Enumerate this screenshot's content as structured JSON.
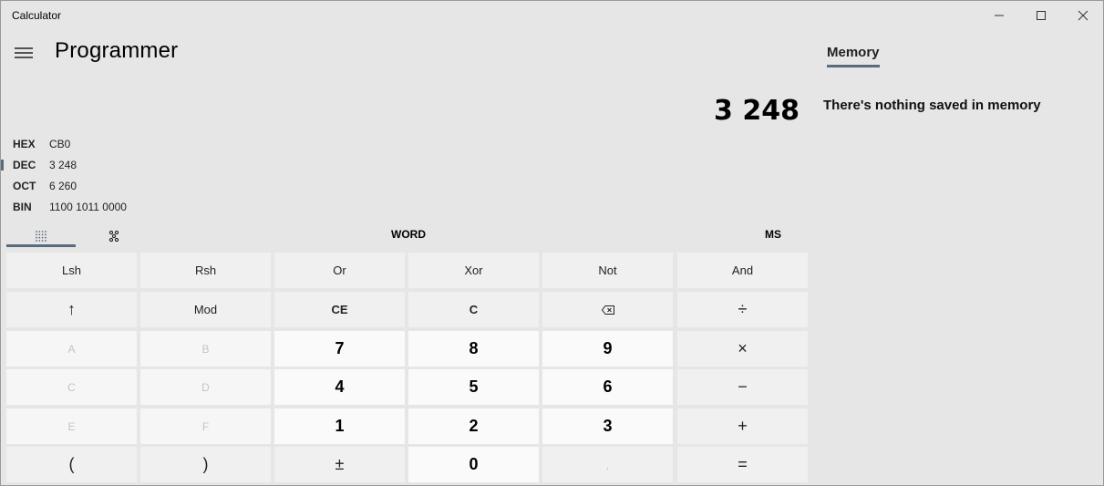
{
  "window": {
    "title": "Calculator",
    "controls": [
      "minimize-icon",
      "maximize-icon",
      "close-icon"
    ]
  },
  "header": {
    "menu_icon": "hamburger-menu-icon",
    "mode": "Programmer"
  },
  "display": {
    "value": "3 248"
  },
  "radix": [
    {
      "label": "HEX",
      "value": "CB0"
    },
    {
      "label": "DEC",
      "value": "3 248",
      "selected": true
    },
    {
      "label": "OCT",
      "value": "6 260"
    },
    {
      "label": "BIN",
      "value": "1100 1011 0000"
    }
  ],
  "toolbar": {
    "keypad_tab_icon": "full-keypad-icon",
    "bit_toggle_tab_icon": "bit-toggling-keypad-icon",
    "word_size": "WORD",
    "memory_store": "MS"
  },
  "keypad": {
    "row1": [
      "Lsh",
      "Rsh",
      "Or",
      "Xor",
      "Not",
      "And"
    ],
    "row2": [
      "↑",
      "Mod",
      "CE",
      "C",
      "backspace",
      "÷"
    ],
    "row3": [
      "A",
      "B",
      "7",
      "8",
      "9",
      "×"
    ],
    "row4": [
      "C",
      "D",
      "4",
      "5",
      "6",
      "−"
    ],
    "row5": [
      "E",
      "F",
      "1",
      "2",
      "3",
      "+"
    ],
    "row6": [
      "(",
      ")",
      "±",
      "0",
      ",",
      "="
    ]
  },
  "memory": {
    "tab_label": "Memory",
    "empty_message": "There's nothing saved in memory"
  },
  "colors": {
    "background": "#e6e6e6",
    "operator_key": "#f0f0f0",
    "number_key": "#fafafa",
    "accent": "#5b6a7d"
  }
}
